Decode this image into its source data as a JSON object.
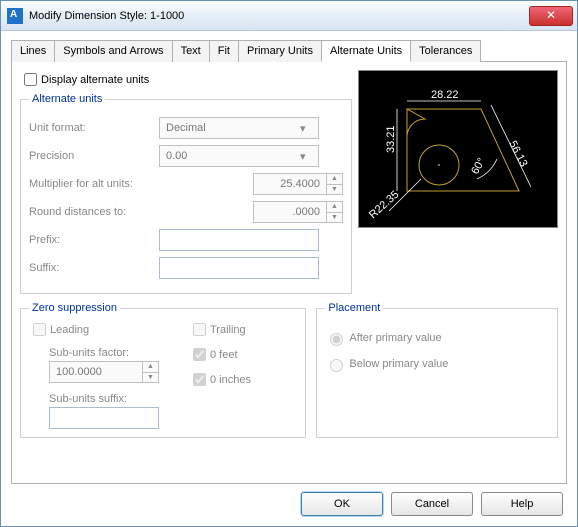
{
  "window": {
    "title": "Modify Dimension Style: 1-1000"
  },
  "tabs": {
    "lines": "Lines",
    "symbols": "Symbols and Arrows",
    "text": "Text",
    "fit": "Fit",
    "primary": "Primary Units",
    "alternate": "Alternate Units",
    "tolerances": "Tolerances"
  },
  "alt": {
    "display_chk": "Display alternate units",
    "group": "Alternate units",
    "unit_format_lbl": "Unit format:",
    "unit_format_val": "Decimal",
    "precision_lbl": "Precision",
    "precision_val": "0.00",
    "multiplier_lbl": "Multiplier for alt units:",
    "multiplier_val": "25.4000",
    "round_lbl": "Round distances to:",
    "round_val": ".0000",
    "prefix_lbl": "Prefix:",
    "suffix_lbl": "Suffix:"
  },
  "zero": {
    "group": "Zero suppression",
    "leading": "Leading",
    "trailing": "Trailing",
    "feet": "0 feet",
    "inches": "0 inches",
    "sub_factor_lbl": "Sub-units factor:",
    "sub_factor_val": "100.0000",
    "sub_suffix_lbl": "Sub-units suffix:"
  },
  "placement": {
    "group": "Placement",
    "after": "After primary value",
    "below": "Below primary value"
  },
  "preview": {
    "top": "28.22",
    "left": "33.21",
    "right": "56.13",
    "radius": "R22.35",
    "angle": "60°"
  },
  "footer": {
    "ok": "OK",
    "cancel": "Cancel",
    "help": "Help"
  }
}
